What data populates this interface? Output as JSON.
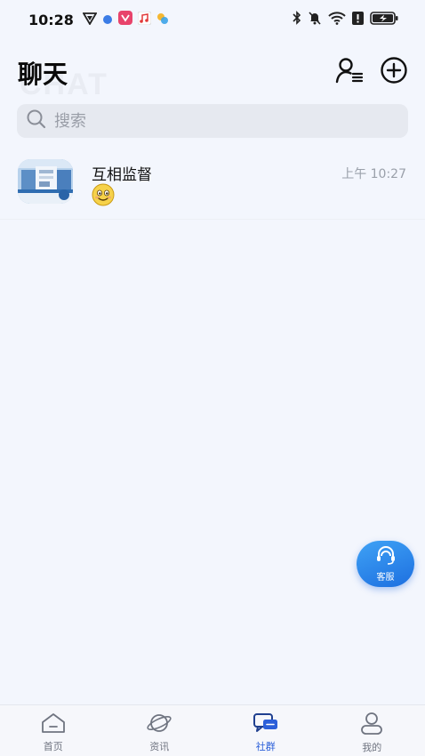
{
  "status_bar": {
    "time": "10:28",
    "left_icons": [
      "vpn-shield-icon",
      "blue-dot-icon",
      "pink-app-icon",
      "music-icon",
      "colorful-app-icon"
    ],
    "right_icons": [
      "bluetooth-icon",
      "mute-icon",
      "wifi-icon",
      "alert-icon",
      "battery-charging-icon"
    ]
  },
  "header": {
    "title": "聊天",
    "watermark": "CHAT",
    "contacts_icon": "contacts-list-icon",
    "add_icon": "plus-circle-icon"
  },
  "search": {
    "placeholder": "搜索",
    "value": ""
  },
  "chats": [
    {
      "name": "互相监督",
      "time": "上午 10:27",
      "preview_icon": "smiley-emoji-icon"
    }
  ],
  "service_button": {
    "label": "客服"
  },
  "bottom_nav": {
    "items": [
      {
        "label": "首页",
        "icon": "home-icon",
        "active": false
      },
      {
        "label": "资讯",
        "icon": "planet-icon",
        "active": false
      },
      {
        "label": "社群",
        "icon": "chat-bubbles-icon",
        "active": true
      },
      {
        "label": "我的",
        "icon": "user-icon",
        "active": false
      }
    ]
  },
  "colors": {
    "accent": "#2b5fd9",
    "background": "#f3f6fd",
    "service_gradient_start": "#3fa2f5",
    "service_gradient_end": "#1d6fe0"
  }
}
